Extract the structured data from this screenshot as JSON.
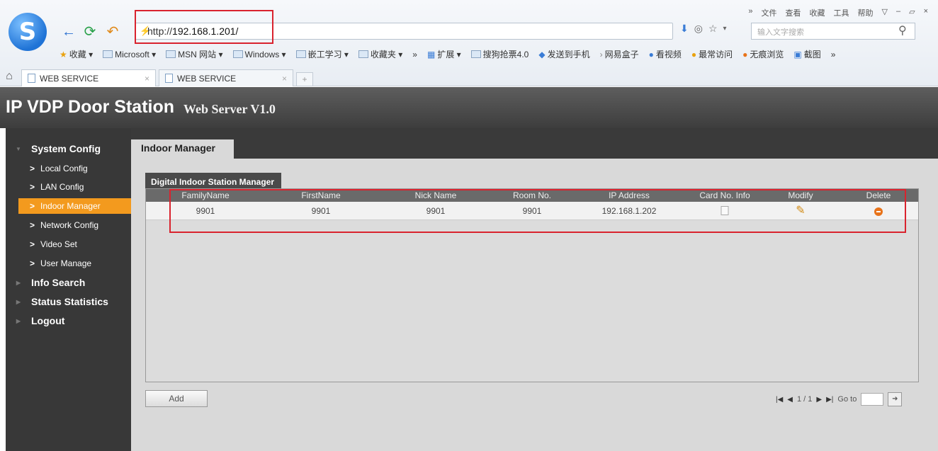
{
  "browser": {
    "menu": [
      "»",
      "文件",
      "查看",
      "收藏",
      "工具",
      "帮助",
      "▽",
      "–",
      "▱",
      "×"
    ],
    "url_prefix": "http://",
    "url_host": "192.168.1.201/",
    "search_placeholder": "输入文字搜索",
    "bookmarks": [
      "收藏 ▾",
      "Microsoft ▾",
      "MSN 网站 ▾",
      "Windows ▾",
      "嵌工学习 ▾",
      "收藏夹 ▾",
      "»",
      "扩展 ▾",
      "搜狗抢票4.0",
      "发送到手机",
      "网易盒子",
      "看视频",
      "最常访问",
      "无痕浏览",
      "截图",
      "»"
    ],
    "tabs": [
      {
        "label": "WEB SERVICE",
        "close": "×"
      },
      {
        "label": "WEB SERVICE",
        "close": "×"
      }
    ],
    "new_tab": "+",
    "highlight_color": "#d9232e"
  },
  "app": {
    "title": "IP VDP Door Station",
    "subtitle": "Web Server V1.0"
  },
  "sidebar": {
    "sections": [
      {
        "label": "System Config"
      },
      {
        "label": "Info Search"
      },
      {
        "label": "Status Statistics"
      },
      {
        "label": "Logout"
      }
    ],
    "items": [
      {
        "label": "Local Config"
      },
      {
        "label": "LAN Config"
      },
      {
        "label": "Indoor Manager"
      },
      {
        "label": "Network Config"
      },
      {
        "label": "Video Set"
      },
      {
        "label": "User Manage"
      }
    ],
    "active_color": "#f39a1e"
  },
  "main": {
    "tab": "Indoor Manager",
    "section_title": "Digital Indoor Station Manager",
    "columns": [
      "FamilyName",
      "FirstName",
      "Nick Name",
      "Room No.",
      "IP Address",
      "Card No. Info",
      "Modify",
      "Delete"
    ],
    "rows": [
      {
        "family": "9901",
        "first": "9901",
        "nick": "9901",
        "room": "9901",
        "ip": "192.168.1.202"
      }
    ],
    "add_label": "Add",
    "pager": {
      "page": "1 / 1",
      "goto": "Go to"
    }
  }
}
